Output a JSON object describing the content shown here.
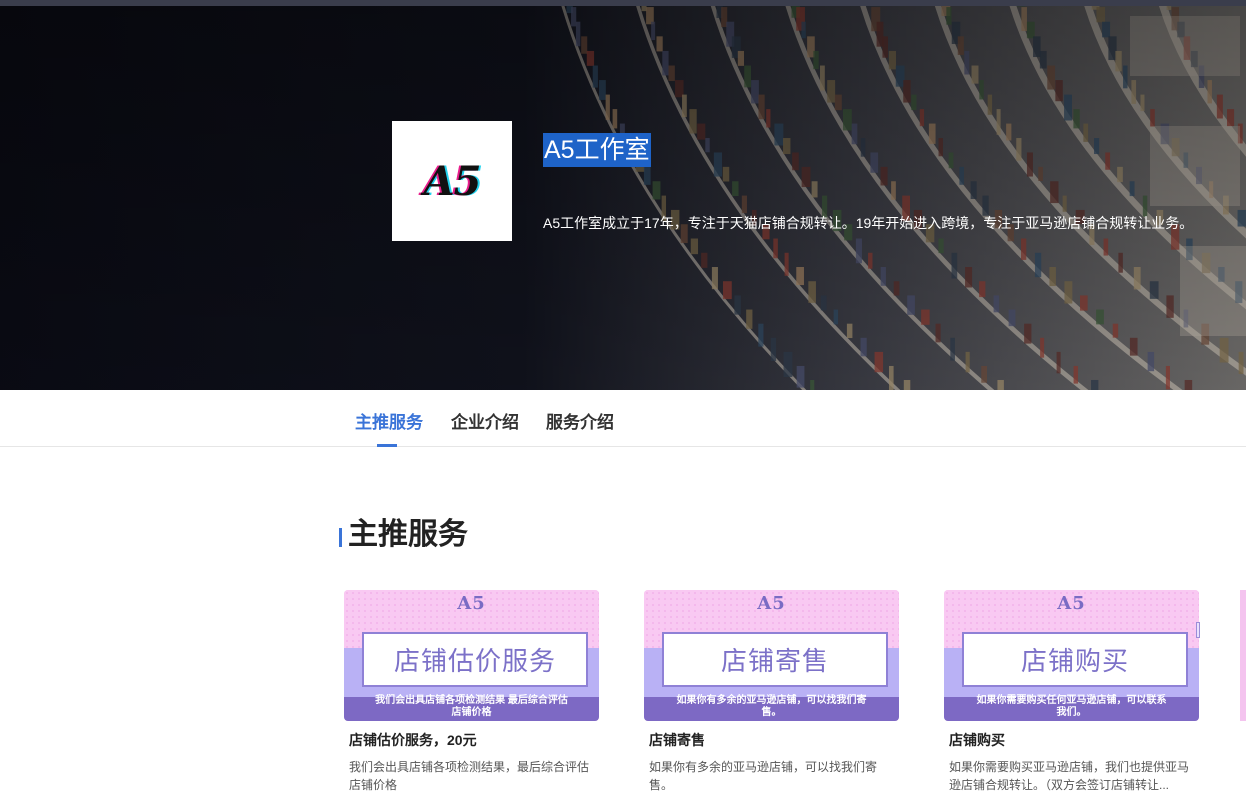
{
  "hero": {
    "logo_text": "A5",
    "studio_name": "A5工作室",
    "description": "A5工作室成立于17年，专注于天猫店铺合规转让。19年开始进入跨境，专注于亚马逊店铺合规转让业务。"
  },
  "tabs": [
    {
      "label": "主推服务",
      "active": true
    },
    {
      "label": "企业介绍",
      "active": false
    },
    {
      "label": "服务介绍",
      "active": false
    }
  ],
  "section": {
    "title": "主推服务"
  },
  "cards": [
    {
      "image_brand": "A5",
      "image_title": "店铺估价服务",
      "image_caption": "我们会出具店铺各项检测结果 最后综合评估店铺价格",
      "title": "店铺估价服务，20元",
      "description": "我们会出具店铺各项检测结果，最后综合评估店铺价格"
    },
    {
      "image_brand": "A5",
      "image_title": "店铺寄售",
      "image_caption": "如果你有多余的亚马逊店铺，可以找我们寄售。",
      "title": "店铺寄售",
      "description": "如果你有多余的亚马逊店铺，可以找我们寄售。"
    },
    {
      "image_brand": "A5",
      "image_title": "店铺购买",
      "image_caption": "如果你需要购买任何亚马逊店铺，可以联系我们。",
      "title": "店铺购买",
      "description": "如果你需要购买亚马逊店铺，我们也提供亚马逊店铺合规转让。（双方会签订店铺转让..."
    }
  ],
  "colors": {
    "accent": "#3a74d8",
    "selection": "#1e63c8",
    "card_pink": "#f9c9f2",
    "card_lavender": "#b9b1f5",
    "card_purple": "#7d69c4"
  }
}
